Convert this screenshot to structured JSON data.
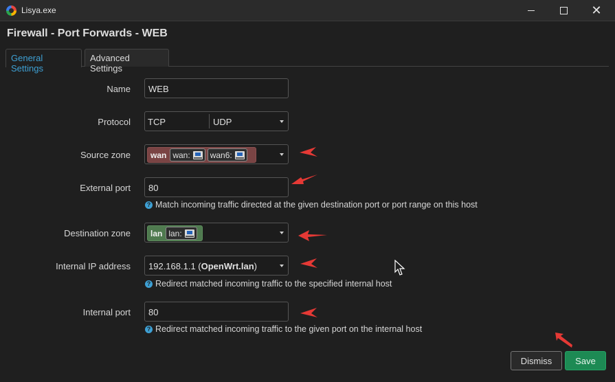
{
  "window": {
    "title": "Lisya.exe",
    "minimize_icon": "minimize-icon",
    "maximize_icon": "maximize-icon",
    "close_icon": "close-icon"
  },
  "page": {
    "title": "Firewall - Port Forwards - WEB"
  },
  "tabs": [
    {
      "label": "General Settings",
      "active": true
    },
    {
      "label": "Advanced Settings",
      "active": false
    }
  ],
  "form": {
    "name": {
      "label": "Name",
      "value": "WEB"
    },
    "protocol": {
      "label": "Protocol",
      "options": [
        "TCP",
        "UDP"
      ]
    },
    "source_zone": {
      "label": "Source zone",
      "zone": "wan",
      "color": "#7a4444",
      "interfaces": [
        "wan:",
        "wan6:"
      ]
    },
    "external_port": {
      "label": "External port",
      "value": "80",
      "help": "Match incoming traffic directed at the given destination port or port range on this host"
    },
    "destination_zone": {
      "label": "Destination zone",
      "zone": "lan",
      "color": "#4f7a4f",
      "interfaces": [
        "lan:"
      ]
    },
    "internal_ip": {
      "label": "Internal IP address",
      "value_ip": "192.168.1.1 (",
      "value_host": "OpenWrt.lan",
      "value_close": ")",
      "help": "Redirect matched incoming traffic to the specified internal host"
    },
    "internal_port": {
      "label": "Internal port",
      "value": "80",
      "help": "Redirect matched incoming traffic to the given port on the internal host"
    }
  },
  "buttons": {
    "dismiss": "Dismiss",
    "save": "Save"
  },
  "colors": {
    "accent": "#3ea0d4",
    "save": "#1d8a54",
    "annotation_arrow": "#e53935"
  }
}
